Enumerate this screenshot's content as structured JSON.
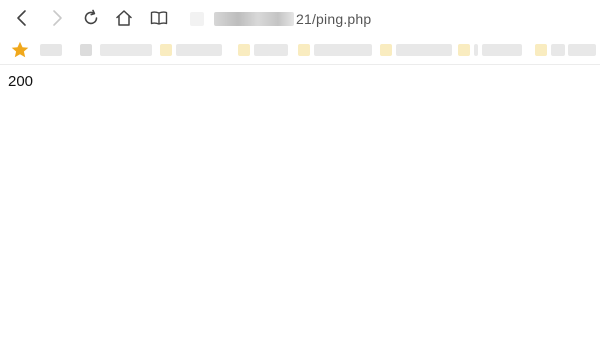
{
  "browser": {
    "address_bar": {
      "url_visible": "21/ping.php"
    }
  },
  "page": {
    "body_text": "200"
  }
}
